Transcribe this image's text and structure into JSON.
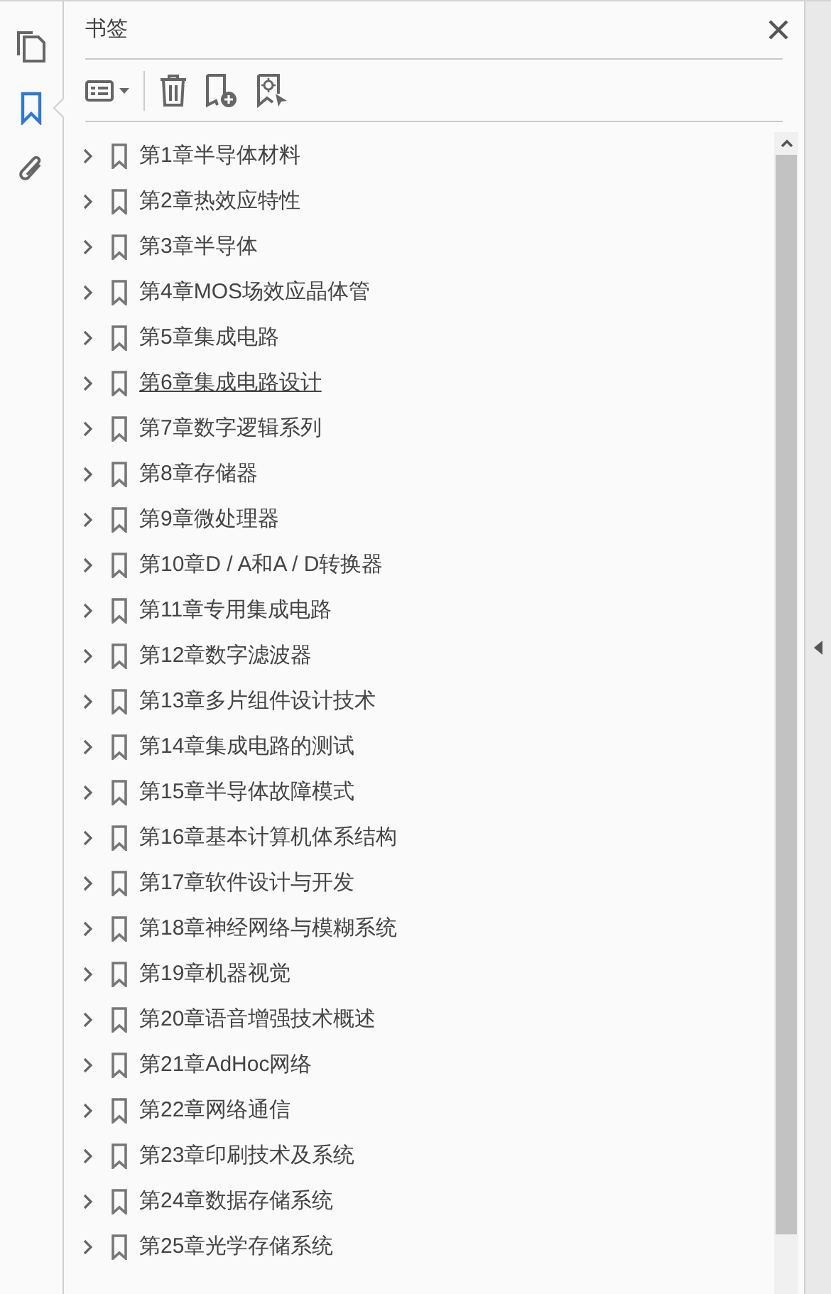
{
  "rail": [
    {
      "kind": "pages",
      "selected": false
    },
    {
      "kind": "bookmarks",
      "selected": true
    },
    {
      "kind": "attachments",
      "selected": false
    }
  ],
  "panel": {
    "title": "书签"
  },
  "bookmarks": [
    {
      "label": "第1章半导体材料",
      "hovered": false
    },
    {
      "label": "第2章热效应特性",
      "hovered": false
    },
    {
      "label": "第3章半导体",
      "hovered": false
    },
    {
      "label": "第4章MOS场效应晶体管",
      "hovered": false
    },
    {
      "label": "第5章集成电路",
      "hovered": false
    },
    {
      "label": "第6章集成电路设计",
      "hovered": true
    },
    {
      "label": "第7章数字逻辑系列",
      "hovered": false
    },
    {
      "label": "第8章存储器",
      "hovered": false
    },
    {
      "label": "第9章微处理器",
      "hovered": false
    },
    {
      "label": "第10章D / A和A / D转换器",
      "hovered": false
    },
    {
      "label": "第11章专用集成电路",
      "hovered": false
    },
    {
      "label": "第12章数字滤波器",
      "hovered": false
    },
    {
      "label": "第13章多片组件设计技术",
      "hovered": false
    },
    {
      "label": "第14章集成电路的测试",
      "hovered": false
    },
    {
      "label": "第15章半导体故障模式",
      "hovered": false
    },
    {
      "label": "第16章基本计算机体系结构",
      "hovered": false
    },
    {
      "label": "第17章软件设计与开发",
      "hovered": false
    },
    {
      "label": "第18章神经网络与模糊系统",
      "hovered": false
    },
    {
      "label": "第19章机器视觉",
      "hovered": false
    },
    {
      "label": "第20章语音增强技术概述",
      "hovered": false
    },
    {
      "label": "第21章AdHoc网络",
      "hovered": false
    },
    {
      "label": "第22章网络通信",
      "hovered": false
    },
    {
      "label": "第23章印刷技术及系统",
      "hovered": false
    },
    {
      "label": "第24章数据存储系统",
      "hovered": false
    },
    {
      "label": "第25章光学存储系统",
      "hovered": false
    }
  ]
}
